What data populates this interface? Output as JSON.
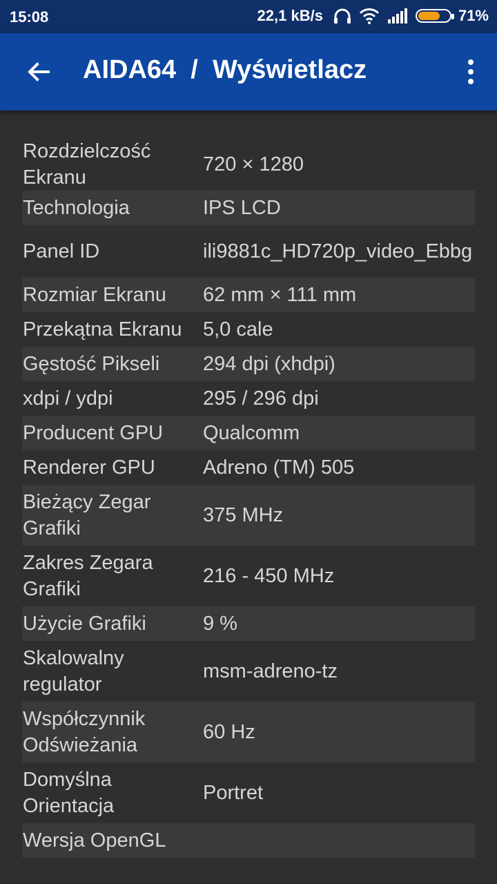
{
  "status_bar": {
    "time": "15:08",
    "speed": "22,1 kB/s",
    "battery_percent": "71%",
    "battery_level": 0.71,
    "icons": [
      "headphones-icon",
      "wifi-icon",
      "signal-icon",
      "battery-icon"
    ]
  },
  "app_bar": {
    "title": "AIDA64  /  Wyświetlacz",
    "color": "#0d47a1"
  },
  "rows": [
    {
      "label": "Rozdzielczość Ekranu",
      "value": "720 × 1280"
    },
    {
      "label": "Technologia",
      "value": "IPS LCD"
    },
    {
      "label": "Panel ID",
      "value": "ili9881c_HD720p_video_Ebbg"
    },
    {
      "label": "Rozmiar Ekranu",
      "value": "62 mm × 111 mm"
    },
    {
      "label": "Przekątna Ekranu",
      "value": "5,0 cale"
    },
    {
      "label": "Gęstość Pikseli",
      "value": "294 dpi (xhdpi)"
    },
    {
      "label": "xdpi / ydpi",
      "value": "295 / 296 dpi"
    },
    {
      "label": "Producent GPU",
      "value": "Qualcomm"
    },
    {
      "label": "Renderer GPU",
      "value": "Adreno (TM) 505"
    },
    {
      "label": "Bieżący Zegar Grafiki",
      "value": "375 MHz"
    },
    {
      "label": "Zakres Zegara Grafiki",
      "value": "216 - 450 MHz"
    },
    {
      "label": "Użycie Grafiki",
      "value": "9 %"
    },
    {
      "label": "Skalowalny regulator",
      "value": "msm-adreno-tz"
    },
    {
      "label": "Współczynnik Odświeżania",
      "value": "60 Hz"
    },
    {
      "label": "Domyślna Orientacja",
      "value": "Portret"
    },
    {
      "label": "Wersja OpenGL",
      "value": ""
    }
  ]
}
